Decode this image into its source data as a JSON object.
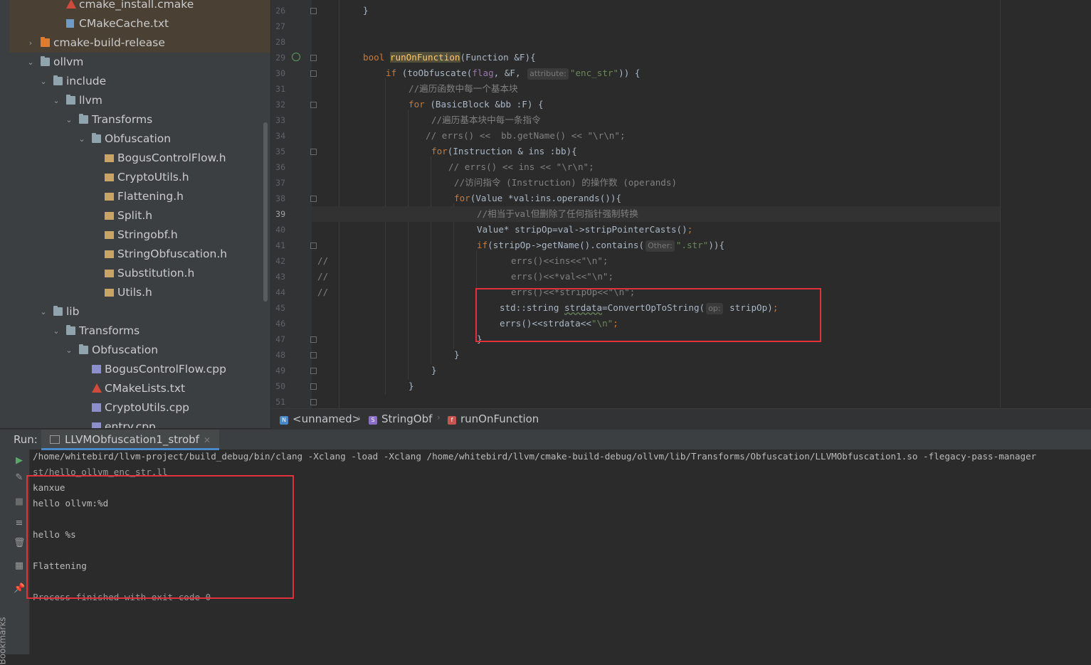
{
  "project_tree": [
    {
      "label": "cmake_install.cmake",
      "icon": "cmake-icon",
      "excluded": true
    },
    {
      "label": "CMakeCache.txt",
      "icon": "text-file-icon",
      "excluded": true
    },
    {
      "label": "cmake-build-release",
      "icon": "folder-icon",
      "excluded": true,
      "collapsed": true
    },
    {
      "label": "ollvm",
      "icon": "folder-icon",
      "expanded": true
    },
    {
      "label": "include",
      "icon": "folder-icon",
      "expanded": true
    },
    {
      "label": "llvm",
      "icon": "folder-icon",
      "expanded": true
    },
    {
      "label": "Transforms",
      "icon": "folder-icon",
      "expanded": true
    },
    {
      "label": "Obfuscation",
      "icon": "folder-icon",
      "expanded": true
    },
    {
      "label": "BogusControlFlow.h",
      "icon": "header-file-icon"
    },
    {
      "label": "CryptoUtils.h",
      "icon": "header-file-icon"
    },
    {
      "label": "Flattening.h",
      "icon": "header-file-icon"
    },
    {
      "label": "Split.h",
      "icon": "header-file-icon"
    },
    {
      "label": "Stringobf.h",
      "icon": "header-file-icon"
    },
    {
      "label": "StringObfuscation.h",
      "icon": "header-file-icon"
    },
    {
      "label": "Substitution.h",
      "icon": "header-file-icon"
    },
    {
      "label": "Utils.h",
      "icon": "header-file-icon"
    },
    {
      "label": "lib",
      "icon": "folder-icon",
      "expanded": true
    },
    {
      "label": "Transforms",
      "icon": "folder-icon",
      "expanded": true
    },
    {
      "label": "Obfuscation",
      "icon": "folder-icon",
      "expanded": true
    },
    {
      "label": "BogusControlFlow.cpp",
      "icon": "cpp-file-icon"
    },
    {
      "label": "CMakeLists.txt",
      "icon": "cmake-icon"
    },
    {
      "label": "CryptoUtils.cpp",
      "icon": "cpp-file-icon"
    },
    {
      "label": "entry.cpp",
      "icon": "cpp-file-icon"
    }
  ],
  "editor": {
    "line_numbers": [
      "26",
      "27",
      "28",
      "29",
      "30",
      "31",
      "32",
      "33",
      "34",
      "35",
      "36",
      "37",
      "38",
      "39",
      "40",
      "41",
      "42",
      "43",
      "44",
      "45",
      "46",
      "47",
      "48",
      "49",
      "50",
      "51"
    ],
    "current_line": "39",
    "code": {
      "l26_brace": "}",
      "l29_kw": "bool ",
      "l29_fn": "runOnFunction",
      "l29_rest": "(Function &F){",
      "l30_kw": "if ",
      "l30_a": "(toObfuscate(",
      "l30_var": "flag",
      "l30_b": ", &F, ",
      "l30_hint": "attribute:",
      "l30_str": "\"enc_str\"",
      "l30_c": ")) {",
      "l31": "//遍历函数中每一个基本块",
      "l32_kw": "for ",
      "l32_rest": "(BasicBlock &bb :F) {",
      "l33": "//遍历基本块中每一条指令",
      "l34_cm": "// errs() <<  bb.getName() << \"\\r\\n\";",
      "l35_kw": "for",
      "l35_rest": "(Instruction & ins :bb){",
      "l36_cm": "// errs() << ins << \"\\r\\n\";",
      "l37": "//访问指令 (Instruction) 的操作数 (operands)",
      "l38_kw": "for",
      "l38_rest": "(Value *val:ins.operands()){",
      "l39": "//相当于val但删除了任何指针强制转换",
      "l40_a": "Value* stripOp=val->stripPointerCasts()",
      "l40_semi": ";",
      "l41_kw": "if",
      "l41_a": "(stripOp->getName().contains(",
      "l41_hint": "Other:",
      "l41_str": "\".str\"",
      "l41_b": ")){",
      "l42_lead": "//",
      "l42": "errs()<<ins<<\"\\n\";",
      "l43_lead": "//",
      "l43": "errs()<<*val<<\"\\n\";",
      "l44_lead": "//",
      "l44": "errs()<<*stripOp<<\"\\n\";",
      "l45_a": "std::string ",
      "l45_sq": "strdata",
      "l45_b": "=ConvertOpToString(",
      "l45_hint": "op:",
      "l45_c": " stripOp)",
      "l45_semi": ";",
      "l46_a": "errs()<<strdata<<",
      "l46_str": "\"\\n\"",
      "l46_semi": ";",
      "l47": "}",
      "l48": "}",
      "l49": "}",
      "l50": "}"
    }
  },
  "breadcrumb": [
    {
      "label": "<unnamed>",
      "icon": "namespace-icon",
      "icon_letter": "N",
      "color": "#4a88c7"
    },
    {
      "label": "StringObf",
      "icon": "struct-icon",
      "icon_letter": "S",
      "color": "#8c6fc9"
    },
    {
      "label": "runOnFunction",
      "icon": "function-icon",
      "icon_letter": "f",
      "color": "#c75450"
    }
  ],
  "run_panel": {
    "title": "Run:",
    "tab_label": "LLVMObfuscation1_strobf",
    "console": [
      "/home/whitebird/llvm-project/build_debug/bin/clang -Xclang -load -Xclang /home/whitebird/llvm/cmake-build-debug/ollvm/lib/Transforms/Obfuscation/LLVMObfuscation1.so -flegacy-pass-manager",
      "st/hello_ollvm_enc_str.ll",
      "kanxue",
      "hello ollvm:%d",
      "",
      "hello %s",
      "",
      "Flattening",
      "",
      "Process finished with exit code 0"
    ],
    "bookmarks_label": "Bookmarks"
  }
}
